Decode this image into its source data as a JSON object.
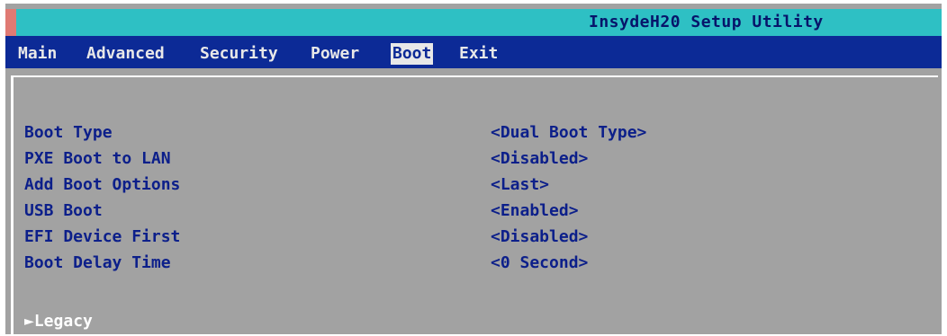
{
  "window": {
    "title": "InsydeH20 Setup Utility"
  },
  "menu": {
    "items": [
      {
        "label": "Main"
      },
      {
        "label": "Advanced"
      },
      {
        "label": "Security"
      },
      {
        "label": "Power"
      },
      {
        "label": "Boot"
      },
      {
        "label": "Exit"
      }
    ],
    "active": "Boot"
  },
  "settings": [
    {
      "label": "Boot Type",
      "value": "<Dual Boot Type>"
    },
    {
      "label": "PXE Boot to LAN",
      "value": "<Disabled>"
    },
    {
      "label": "Add Boot Options",
      "value": "<Last>"
    },
    {
      "label": "USB Boot",
      "value": "<Enabled>"
    },
    {
      "label": "EFI Device First",
      "value": "<Disabled>"
    },
    {
      "label": "Boot Delay Time",
      "value": "<0 Second>"
    }
  ],
  "submenu": {
    "arrow": "►",
    "label": "Legacy"
  },
  "colors": {
    "titlebar": "#2ec0c4",
    "menubar": "#0c2a96",
    "background": "#a2a2a2",
    "text": "#0c1f8a",
    "highlight_text": "#ffffff"
  }
}
